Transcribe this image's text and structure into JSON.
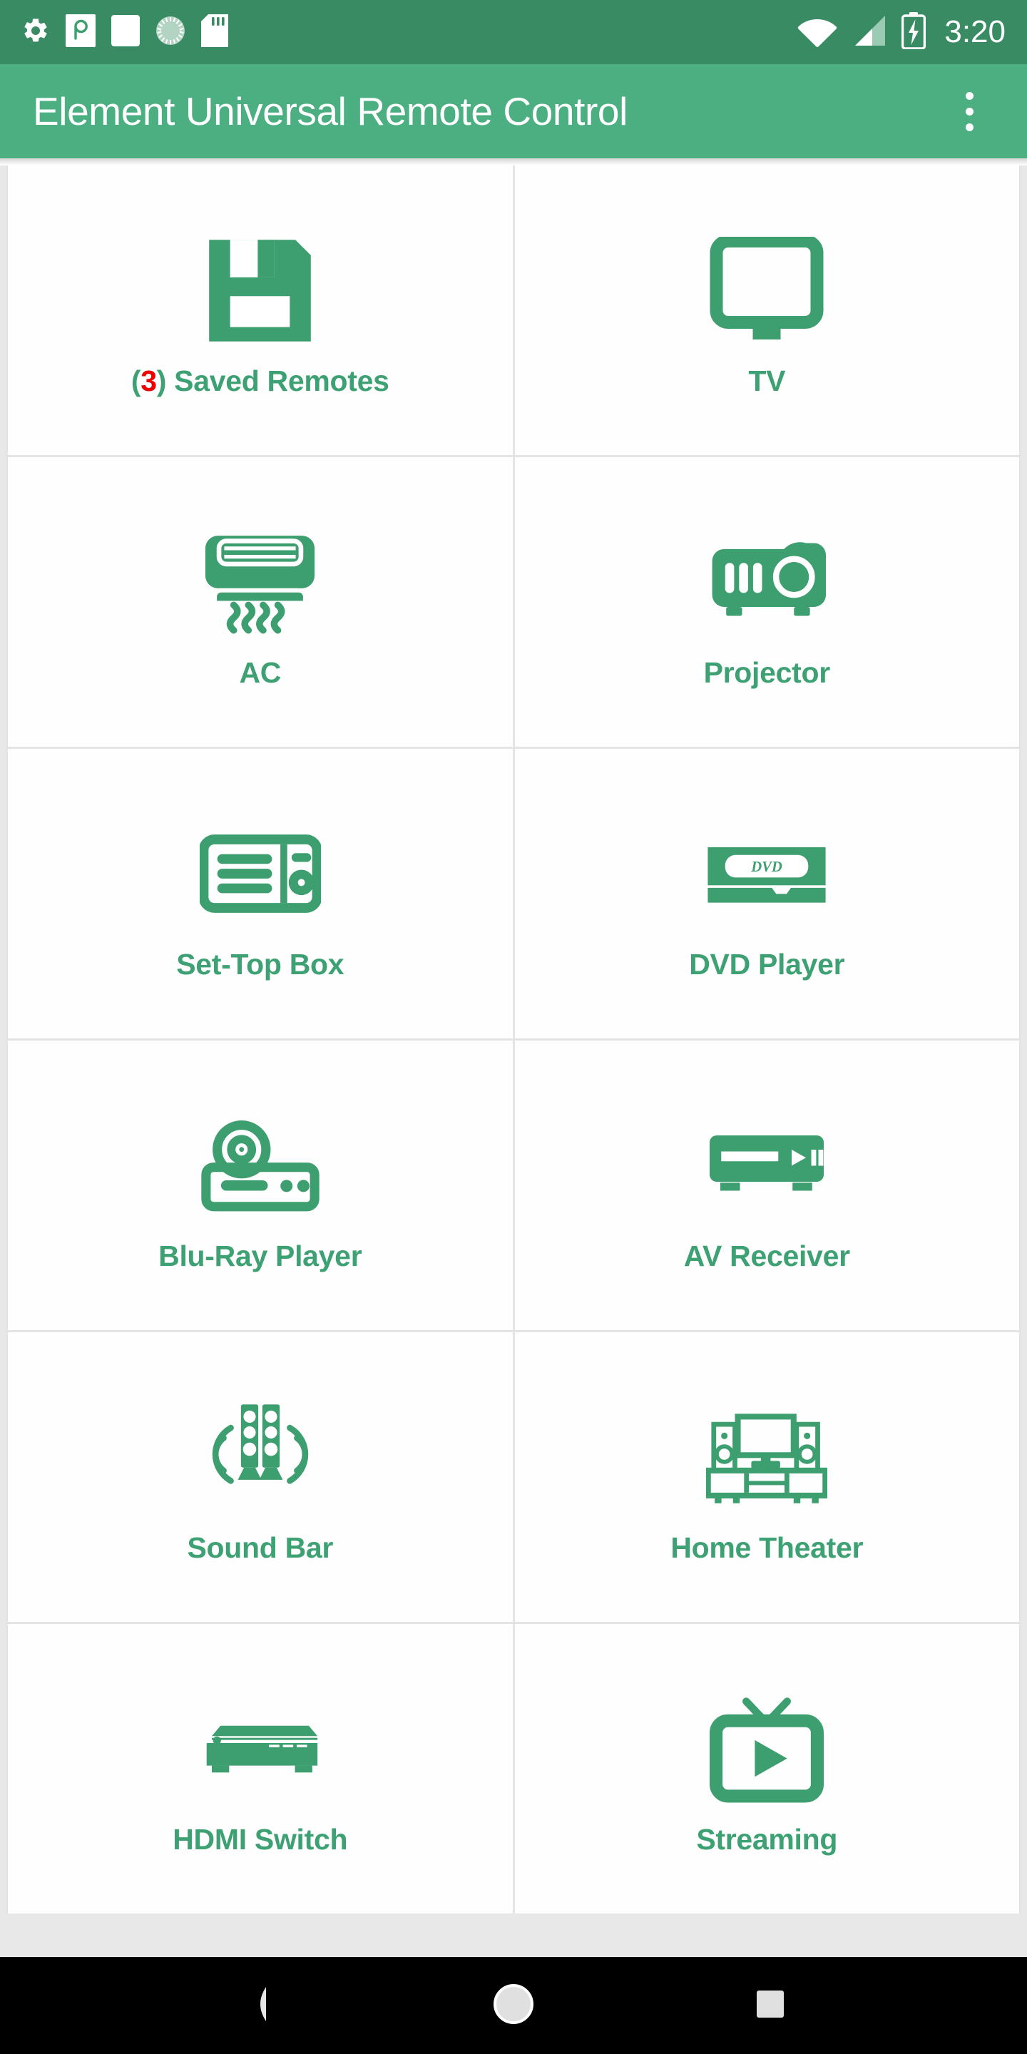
{
  "status_bar": {
    "background_color": "#388b62",
    "time": "3:20",
    "left_icons": [
      {
        "name": "settings-gear-icon",
        "label": "gear"
      },
      {
        "name": "pocketcasts-app-icon",
        "label": "p-app"
      },
      {
        "name": "blank-notification-icon",
        "label": "blank"
      },
      {
        "name": "circular-progress-icon",
        "label": "progress"
      },
      {
        "name": "sd-card-icon",
        "label": "sd-card"
      }
    ],
    "right_icons": [
      {
        "name": "wifi-icon",
        "label": "wifi"
      },
      {
        "name": "cellular-signal-icon",
        "label": "signal"
      },
      {
        "name": "battery-charging-icon",
        "label": "battery"
      }
    ]
  },
  "app_bar": {
    "title": "Element Universal Remote Control",
    "background_color": "#4caf82",
    "text_color": "#ffffff",
    "overflow_menu_label": "More options"
  },
  "theme": {
    "accent_green": "#3da173",
    "icon_green": "#3d9e6f",
    "count_red": "#ee0000",
    "divider": "#e4e4e4",
    "cell_background": "#fefefe"
  },
  "grid": {
    "columns": 2,
    "items": [
      {
        "id": "saved-remotes",
        "label": "Saved Remotes",
        "count": "3",
        "label_prefix_open": "(",
        "label_prefix_close": ")",
        "icon": "floppy-disk-save-icon"
      },
      {
        "id": "tv",
        "label": "TV",
        "icon": "tv-monitor-icon"
      },
      {
        "id": "ac",
        "label": "AC",
        "icon": "air-conditioner-icon"
      },
      {
        "id": "projector",
        "label": "Projector",
        "icon": "projector-icon"
      },
      {
        "id": "set-top-box",
        "label": "Set-Top Box",
        "icon": "set-top-box-icon"
      },
      {
        "id": "dvd-player",
        "label": "DVD Player",
        "icon": "dvd-player-icon",
        "icon_text": "DVD"
      },
      {
        "id": "blu-ray-player",
        "label": "Blu-Ray Player",
        "icon": "blu-ray-player-icon"
      },
      {
        "id": "av-receiver",
        "label": "AV Receiver",
        "icon": "av-receiver-icon"
      },
      {
        "id": "sound-bar",
        "label": "Sound Bar",
        "icon": "sound-bar-speakers-icon"
      },
      {
        "id": "home-theater",
        "label": "Home Theater",
        "icon": "home-theater-icon"
      },
      {
        "id": "hdmi-switch",
        "label": "HDMI Switch",
        "icon": "hdmi-switch-icon"
      },
      {
        "id": "streaming",
        "label": "Streaming",
        "icon": "streaming-tv-play-icon"
      }
    ]
  },
  "nav_bar": {
    "background_color": "#000000",
    "buttons": [
      {
        "name": "back-button",
        "icon": "back-triangle-icon"
      },
      {
        "name": "home-button",
        "icon": "home-circle-icon"
      },
      {
        "name": "recents-button",
        "icon": "recents-square-icon"
      }
    ]
  }
}
